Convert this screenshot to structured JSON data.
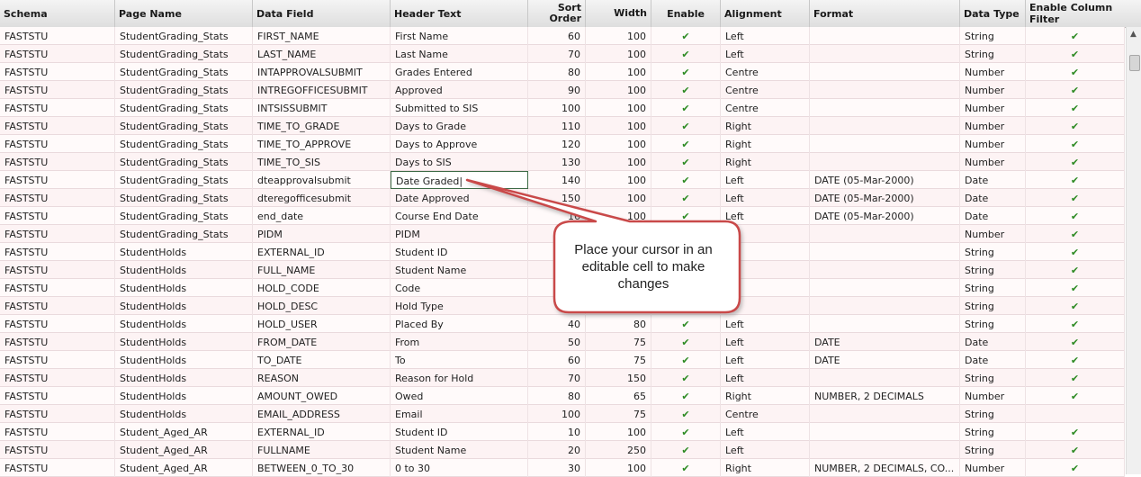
{
  "columns": [
    "Schema",
    "Page Name",
    "Data Field",
    "Header Text",
    "Sort Order",
    "Width",
    "Enable",
    "Alignment",
    "Format",
    "Data Type",
    "Enable Column Filter"
  ],
  "check_glyph": "✔",
  "rows": [
    {
      "schema": "FASTSTU",
      "page": "StudentGrading_Stats",
      "field": "FIRST_NAME",
      "header": "First Name",
      "sort": "60",
      "width": "100",
      "enable": true,
      "align": "Left",
      "format": "",
      "type": "String",
      "filter": true
    },
    {
      "schema": "FASTSTU",
      "page": "StudentGrading_Stats",
      "field": "LAST_NAME",
      "header": "Last Name",
      "sort": "70",
      "width": "100",
      "enable": true,
      "align": "Left",
      "format": "",
      "type": "String",
      "filter": true
    },
    {
      "schema": "FASTSTU",
      "page": "StudentGrading_Stats",
      "field": "INTAPPROVALSUBMIT",
      "header": "Grades Entered",
      "sort": "80",
      "width": "100",
      "enable": true,
      "align": "Centre",
      "format": "",
      "type": "Number",
      "filter": true
    },
    {
      "schema": "FASTSTU",
      "page": "StudentGrading_Stats",
      "field": "INTREGOFFICESUBMIT",
      "header": "Approved",
      "sort": "90",
      "width": "100",
      "enable": true,
      "align": "Centre",
      "format": "",
      "type": "Number",
      "filter": true
    },
    {
      "schema": "FASTSTU",
      "page": "StudentGrading_Stats",
      "field": "INTSISSUBMIT",
      "header": "Submitted to SIS",
      "sort": "100",
      "width": "100",
      "enable": true,
      "align": "Centre",
      "format": "",
      "type": "Number",
      "filter": true
    },
    {
      "schema": "FASTSTU",
      "page": "StudentGrading_Stats",
      "field": "TIME_TO_GRADE",
      "header": "Days to Grade",
      "sort": "110",
      "width": "100",
      "enable": true,
      "align": "Right",
      "format": "",
      "type": "Number",
      "filter": true
    },
    {
      "schema": "FASTSTU",
      "page": "StudentGrading_Stats",
      "field": "TIME_TO_APPROVE",
      "header": "Days to Approve",
      "sort": "120",
      "width": "100",
      "enable": true,
      "align": "Right",
      "format": "",
      "type": "Number",
      "filter": true
    },
    {
      "schema": "FASTSTU",
      "page": "StudentGrading_Stats",
      "field": "TIME_TO_SIS",
      "header": "Days to SIS",
      "sort": "130",
      "width": "100",
      "enable": true,
      "align": "Right",
      "format": "",
      "type": "Number",
      "filter": true
    },
    {
      "schema": "FASTSTU",
      "page": "StudentGrading_Stats",
      "field": "dteapprovalsubmit",
      "header": "Date Graded",
      "sort": "140",
      "width": "100",
      "enable": true,
      "align": "Left",
      "format": "DATE (05-Mar-2000)",
      "type": "Date",
      "filter": true,
      "editing": true
    },
    {
      "schema": "FASTSTU",
      "page": "StudentGrading_Stats",
      "field": "dteregofficesubmit",
      "header": "Date Approved",
      "sort": "150",
      "width": "100",
      "enable": true,
      "align": "Left",
      "format": "DATE (05-Mar-2000)",
      "type": "Date",
      "filter": true
    },
    {
      "schema": "FASTSTU",
      "page": "StudentGrading_Stats",
      "field": "end_date",
      "header": "Course End Date",
      "sort": "16",
      "width": "100",
      "enable": true,
      "align": "Left",
      "format": "DATE (05-Mar-2000)",
      "type": "Date",
      "filter": true
    },
    {
      "schema": "FASTSTU",
      "page": "StudentGrading_Stats",
      "field": "PIDM",
      "header": "PIDM",
      "sort": "",
      "width": "",
      "enable": false,
      "align": "",
      "format": "",
      "type": "Number",
      "filter": true
    },
    {
      "schema": "FASTSTU",
      "page": "StudentHolds",
      "field": "EXTERNAL_ID",
      "header": "Student ID",
      "sort": "",
      "width": "",
      "enable": false,
      "align": "",
      "format": "",
      "type": "String",
      "filter": true
    },
    {
      "schema": "FASTSTU",
      "page": "StudentHolds",
      "field": "FULL_NAME",
      "header": "Student Name",
      "sort": "",
      "width": "",
      "enable": false,
      "align": "",
      "format": "",
      "type": "String",
      "filter": true
    },
    {
      "schema": "FASTSTU",
      "page": "StudentHolds",
      "field": "HOLD_CODE",
      "header": "Code",
      "sort": "",
      "width": "",
      "enable": false,
      "align": "",
      "format": "",
      "type": "String",
      "filter": true
    },
    {
      "schema": "FASTSTU",
      "page": "StudentHolds",
      "field": "HOLD_DESC",
      "header": "Hold Type",
      "sort": "",
      "width": "",
      "enable": false,
      "align": "",
      "format": "",
      "type": "String",
      "filter": true
    },
    {
      "schema": "FASTSTU",
      "page": "StudentHolds",
      "field": "HOLD_USER",
      "header": "Placed By",
      "sort": "40",
      "width": "80",
      "enable": true,
      "align": "Left",
      "format": "",
      "type": "String",
      "filter": true
    },
    {
      "schema": "FASTSTU",
      "page": "StudentHolds",
      "field": "FROM_DATE",
      "header": "From",
      "sort": "50",
      "width": "75",
      "enable": true,
      "align": "Left",
      "format": "DATE",
      "type": "Date",
      "filter": true
    },
    {
      "schema": "FASTSTU",
      "page": "StudentHolds",
      "field": "TO_DATE",
      "header": "To",
      "sort": "60",
      "width": "75",
      "enable": true,
      "align": "Left",
      "format": "DATE",
      "type": "Date",
      "filter": true
    },
    {
      "schema": "FASTSTU",
      "page": "StudentHolds",
      "field": "REASON",
      "header": "Reason for Hold",
      "sort": "70",
      "width": "150",
      "enable": true,
      "align": "Left",
      "format": "",
      "type": "String",
      "filter": true
    },
    {
      "schema": "FASTSTU",
      "page": "StudentHolds",
      "field": "AMOUNT_OWED",
      "header": "Owed",
      "sort": "80",
      "width": "65",
      "enable": true,
      "align": "Right",
      "format": "NUMBER, 2 DECIMALS",
      "type": "Number",
      "filter": true
    },
    {
      "schema": "FASTSTU",
      "page": "StudentHolds",
      "field": "EMAIL_ADDRESS",
      "header": "Email",
      "sort": "100",
      "width": "75",
      "enable": true,
      "align": "Centre",
      "format": "",
      "type": "String",
      "filter": false
    },
    {
      "schema": "FASTSTU",
      "page": "Student_Aged_AR",
      "field": "EXTERNAL_ID",
      "header": "Student ID",
      "sort": "10",
      "width": "100",
      "enable": true,
      "align": "Left",
      "format": "",
      "type": "String",
      "filter": true
    },
    {
      "schema": "FASTSTU",
      "page": "Student_Aged_AR",
      "field": "FULLNAME",
      "header": "Student Name",
      "sort": "20",
      "width": "250",
      "enable": true,
      "align": "Left",
      "format": "",
      "type": "String",
      "filter": true
    },
    {
      "schema": "FASTSTU",
      "page": "Student_Aged_AR",
      "field": "BETWEEN_0_TO_30",
      "header": "0 to 30",
      "sort": "30",
      "width": "100",
      "enable": true,
      "align": "Right",
      "format": "NUMBER, 2 DECIMALS, CO...",
      "type": "Number",
      "filter": true
    }
  ],
  "callout": {
    "text": "Place your cursor in an editable cell to make changes"
  },
  "scrollbar": {
    "up_arrow": "▲"
  }
}
